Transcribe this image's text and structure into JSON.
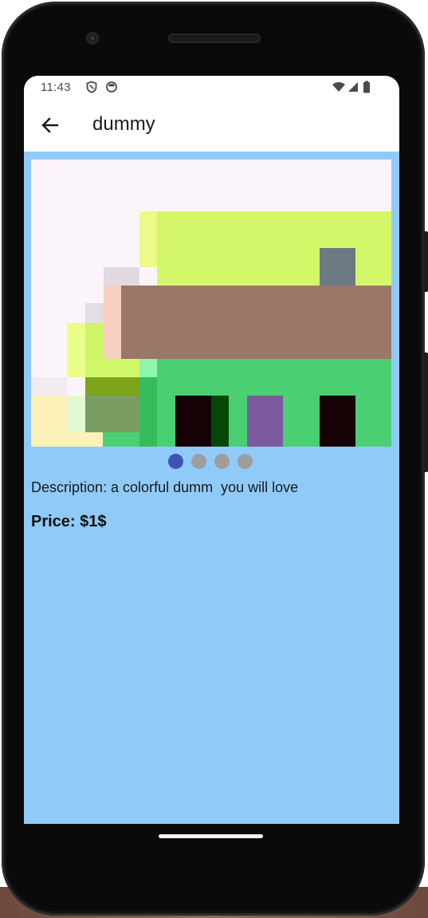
{
  "status_bar": {
    "time": "11:43",
    "left_icons": [
      "shield-icon",
      "circle-status-icon"
    ],
    "right_icons": [
      "wifi-icon",
      "signal-icon",
      "battery-icon"
    ]
  },
  "app_bar": {
    "back_icon": "arrow-left-icon",
    "title": "dummy"
  },
  "product": {
    "image_alt": "pixel art product image",
    "carousel": {
      "page_count": 4,
      "active_index": 0,
      "active_color": "#3f51b5",
      "inactive_color": "#9e9e9e"
    },
    "description": "Description: a colorful dumm  you will love",
    "price": "Price: $1$"
  },
  "colors": {
    "background": "#90caf9",
    "app_bar": "#ffffff"
  }
}
